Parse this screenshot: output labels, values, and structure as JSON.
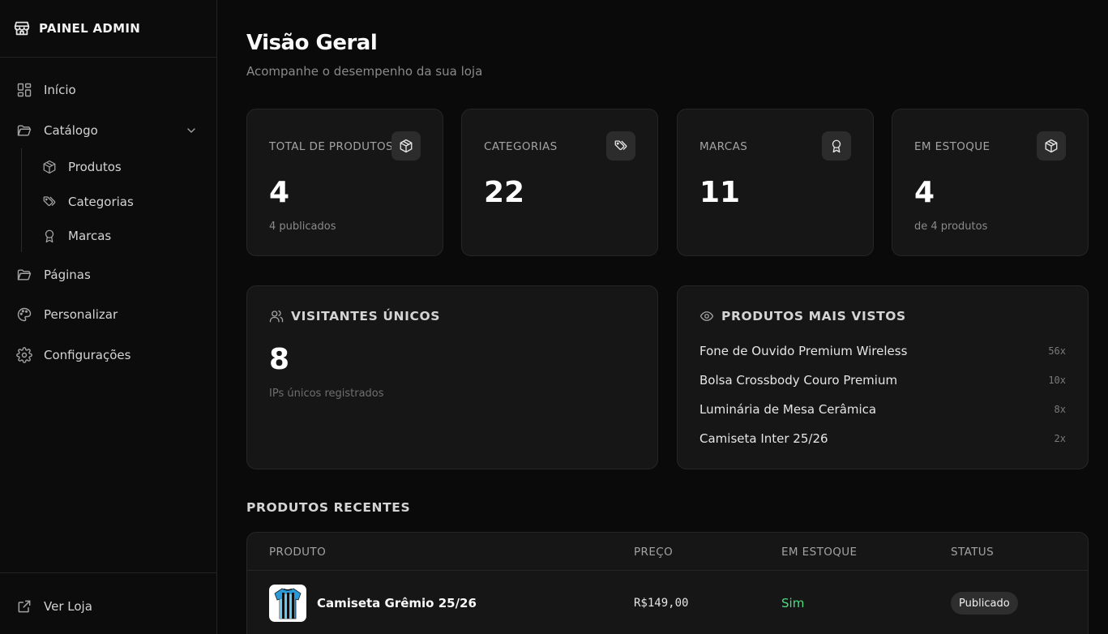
{
  "brand": {
    "title": "PAINEL ADMIN",
    "icon": "store-icon"
  },
  "sidebar": {
    "items": [
      {
        "label": "Início",
        "icon": "grid-icon"
      },
      {
        "label": "Catálogo",
        "icon": "folder-open-icon",
        "expanded": true
      },
      {
        "label": "Páginas",
        "icon": "folder-open-icon"
      },
      {
        "label": "Personalizar",
        "icon": "palette-icon"
      },
      {
        "label": "Configurações",
        "icon": "gear-icon"
      }
    ],
    "catalog_sub": [
      {
        "label": "Produtos",
        "icon": "box-icon"
      },
      {
        "label": "Categorias",
        "icon": "tags-icon"
      },
      {
        "label": "Marcas",
        "icon": "award-icon"
      }
    ],
    "footer": {
      "label": "Ver Loja",
      "icon": "external-link-icon"
    }
  },
  "header": {
    "title": "Visão Geral",
    "subtitle": "Acompanhe o desempenho da sua loja"
  },
  "stats": [
    {
      "label": "TOTAL DE PRODUTOS",
      "value": "4",
      "sub": "4 publicados",
      "icon": "box-icon"
    },
    {
      "label": "CATEGORIAS",
      "value": "22",
      "sub": "",
      "icon": "tags-icon"
    },
    {
      "label": "MARCAS",
      "value": "11",
      "sub": "",
      "icon": "award-icon"
    },
    {
      "label": "EM ESTOQUE",
      "value": "4",
      "sub": "de 4 produtos",
      "icon": "box-icon"
    }
  ],
  "visitors": {
    "title": "VISITANTES ÚNICOS",
    "value": "8",
    "sub": "IPs únicos registrados",
    "icon": "users-icon"
  },
  "most_viewed": {
    "title": "PRODUTOS MAIS VISTOS",
    "icon": "eye-icon",
    "items": [
      {
        "name": "Fone de Ouvido Premium Wireless",
        "count": "56x"
      },
      {
        "name": "Bolsa Crossbody Couro Premium",
        "count": "10x"
      },
      {
        "name": "Luminária de Mesa Cerâmica",
        "count": "8x"
      },
      {
        "name": "Camiseta Inter 25/26",
        "count": "2x"
      }
    ]
  },
  "recent": {
    "title": "PRODUTOS RECENTES",
    "columns": [
      "PRODUTO",
      "PREÇO",
      "EM ESTOQUE",
      "STATUS"
    ],
    "rows": [
      {
        "name": "Camiseta Grêmio 25/26",
        "price": "R$149,00",
        "stock": "Sim",
        "status": "Publicado",
        "stock_color": "#4ade80"
      }
    ]
  },
  "colors": {
    "background": "#0a0a0a",
    "card": "#161616",
    "border": "#262626",
    "success": "#4ade80"
  }
}
